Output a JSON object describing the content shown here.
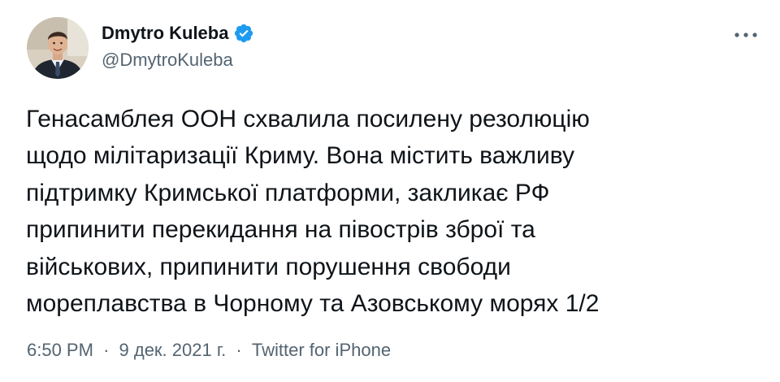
{
  "author": {
    "display_name": "Dmytro Kuleba",
    "handle": "@DmytroKuleba",
    "verified": true,
    "verified_icon": "verified-badge-icon",
    "avatar_icon": "avatar"
  },
  "more_icon": "more-options-icon",
  "tweet": {
    "lines": [
      "Генасамблея ООН схвалила посилену резолюцію",
      "щодо мілітаризації Криму. Вона містить важливу",
      "підтримку Кримської платформи, закликає РФ",
      "припинити перекидання на півострів зброї та",
      "військових, припинити порушення свободи",
      "мореплавства в Чорному та Азовському морях 1/2"
    ]
  },
  "meta": {
    "time": "6:50 PM",
    "separator": "·",
    "date": "9 дек. 2021 г.",
    "source": "Twitter for iPhone"
  },
  "colors": {
    "text": "#0f1419",
    "secondary": "#536471",
    "verified": "#1d9bf0"
  }
}
